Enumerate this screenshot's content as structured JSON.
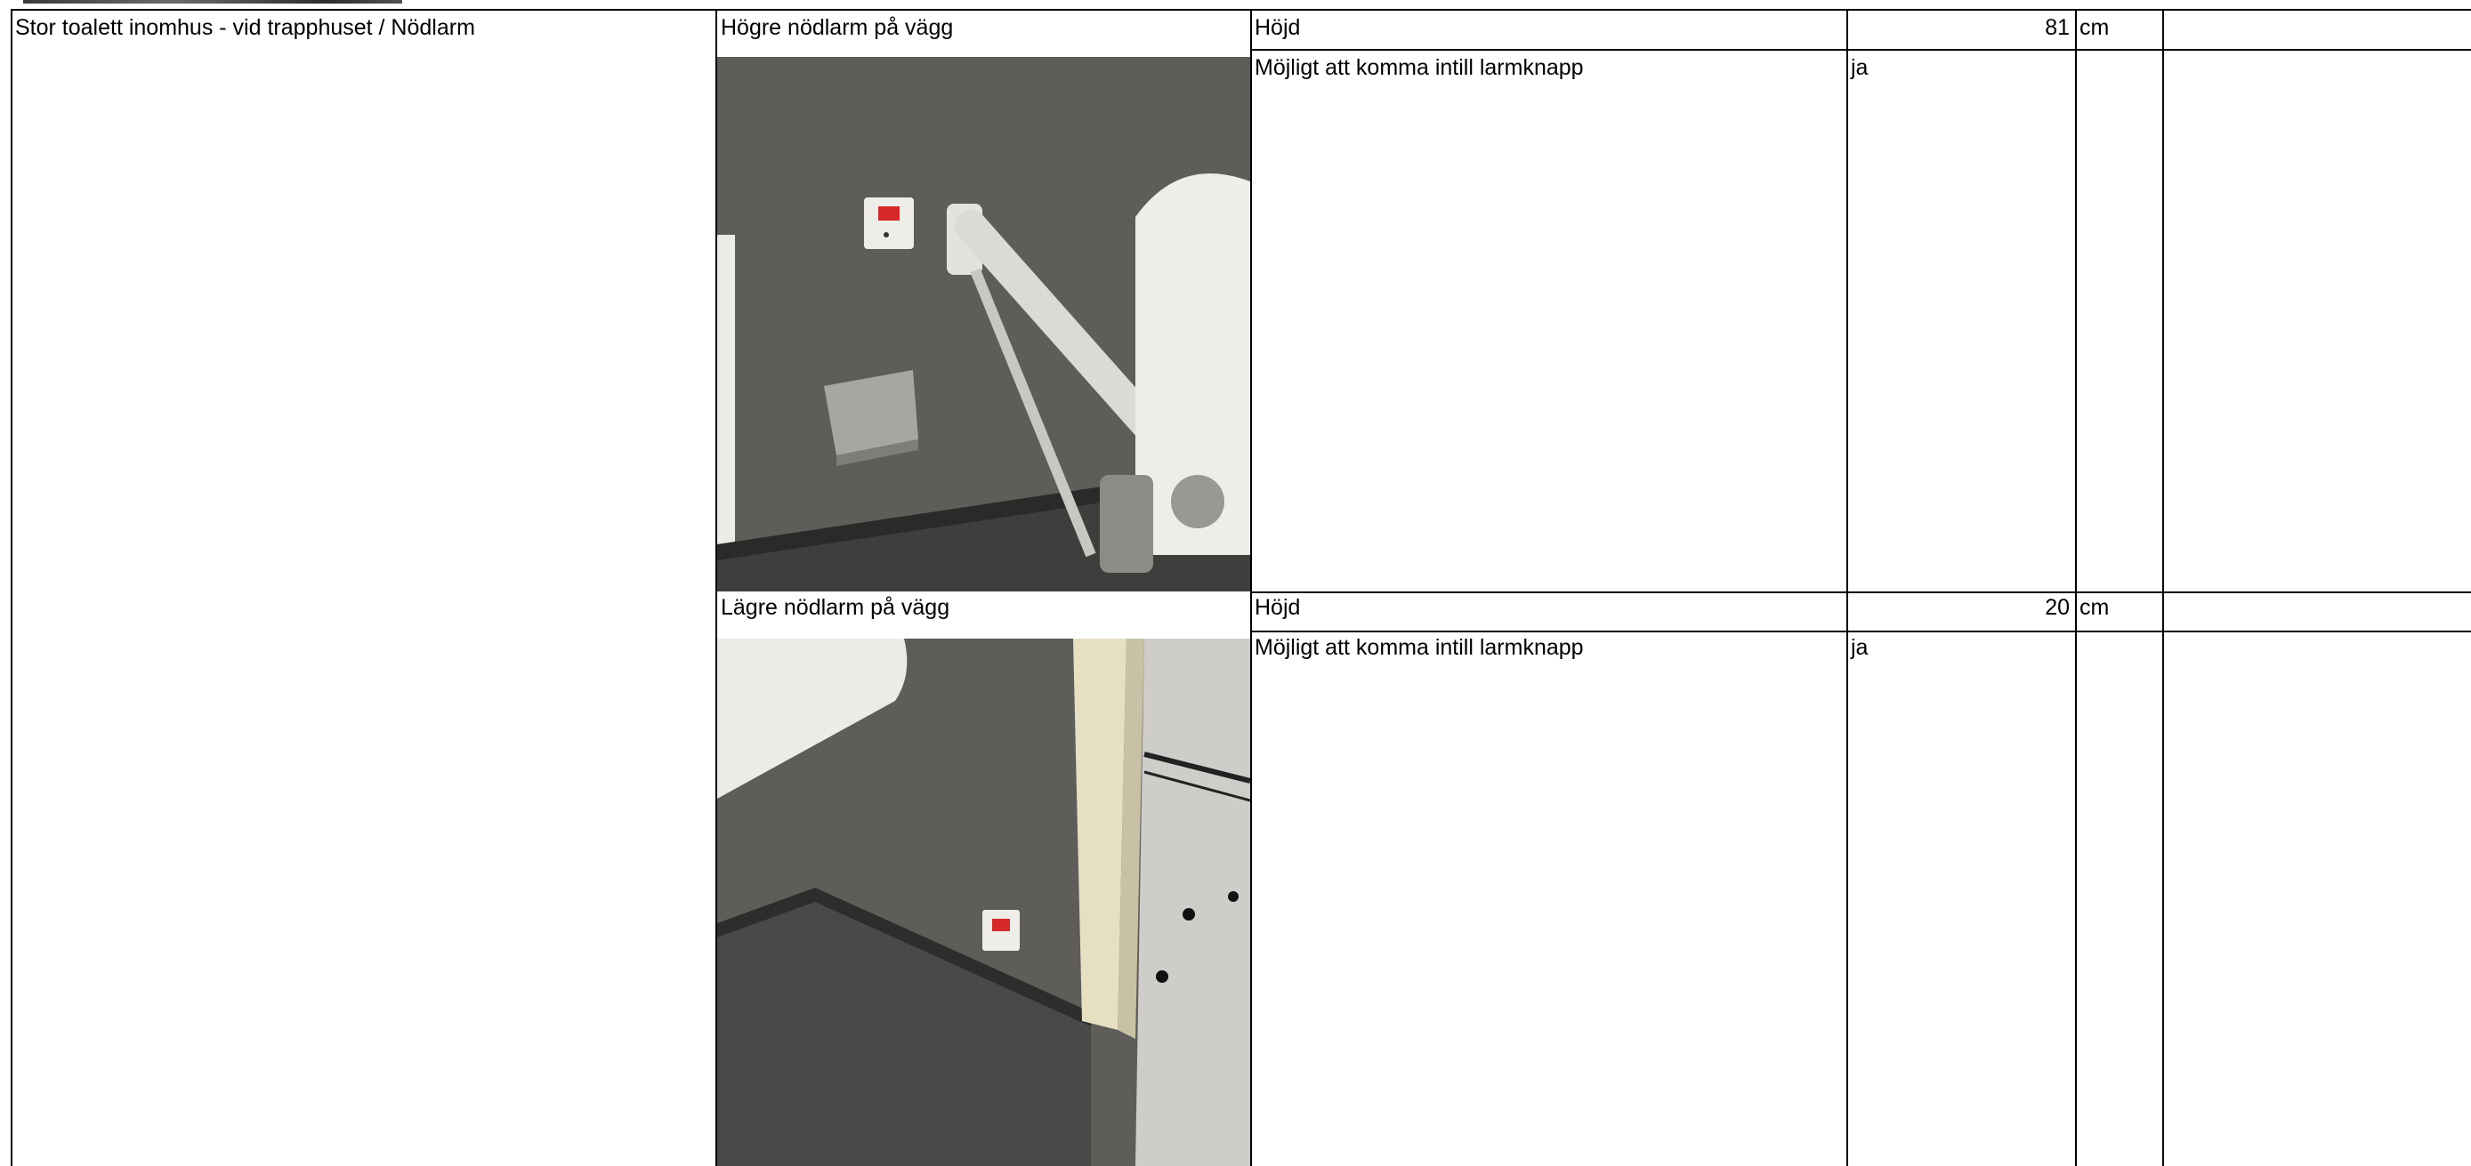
{
  "section": {
    "title": "Stor toalett inomhus - vid trapphuset / Nödlarm"
  },
  "items": [
    {
      "name": "Högre nödlarm på vägg",
      "photo": "photo of bathroom wall with emergency alarm button, support grab rail and fold-down seat",
      "measurements": [
        {
          "label": "Höjd",
          "value": "81",
          "unit": "cm",
          "note": ""
        },
        {
          "label": "Möjligt att komma intill larmknapp",
          "value": "ja",
          "unit": "",
          "note": ""
        }
      ]
    },
    {
      "name": "Lägre nödlarm på vägg",
      "photo": "photo of low emergency alarm button on wall near floor beside washbasin and doorway",
      "measurements": [
        {
          "label": "Höjd",
          "value": "20",
          "unit": "cm",
          "note": ""
        },
        {
          "label": "Möjligt att komma intill larmknapp",
          "value": "ja",
          "unit": "",
          "note": ""
        }
      ]
    }
  ],
  "colors": {
    "wall": "#5f5d5a",
    "floor": "#3f3e3c",
    "fixture": "#e9e6df",
    "alarm": "#d62828"
  }
}
